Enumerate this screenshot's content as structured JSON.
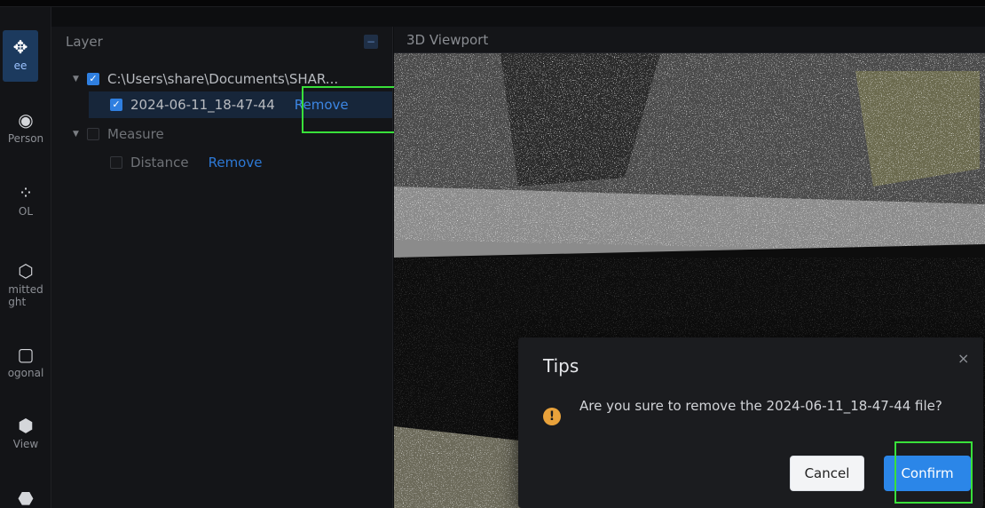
{
  "rail": {
    "tools": [
      {
        "glyph": "✥",
        "label": "ee",
        "icon": "free-view-icon"
      },
      {
        "glyph": "◉",
        "label": "Person",
        "icon": "person-view-icon"
      },
      {
        "glyph": "⁘",
        "label": "OL",
        "icon": "lod-icon"
      },
      {
        "glyph": "⬡",
        "label": "mitted\nght",
        "icon": "limited-height-icon"
      },
      {
        "glyph": "▢",
        "label": "ogonal",
        "icon": "orthogonal-icon"
      },
      {
        "glyph": "⬢",
        "label": "View",
        "icon": "view-cube-icon"
      },
      {
        "glyph": "⬣",
        "label": "",
        "icon": "more-tool-icon"
      }
    ]
  },
  "layer_panel": {
    "title": "Layer",
    "collapse_glyph": "−",
    "root_path": "C:\\Users\\share\\Documents\\SHAR...",
    "file_item": "2024-06-11_18-47-44",
    "file_remove": "Remove",
    "measure_group": "Measure",
    "distance_item": "Distance",
    "distance_remove": "Remove",
    "caret": "▼",
    "check": "✓"
  },
  "viewport": {
    "title": "3D Viewport"
  },
  "dialog": {
    "title": "Tips",
    "close": "×",
    "warn_glyph": "!",
    "message": "Are you sure to remove the 2024-06-11_18-47-44 file?",
    "cancel": "Cancel",
    "confirm": "Confirm"
  },
  "colors": {
    "accent": "#2b86e8",
    "highlight": "#39e03a",
    "warning": "#e9a23b"
  }
}
